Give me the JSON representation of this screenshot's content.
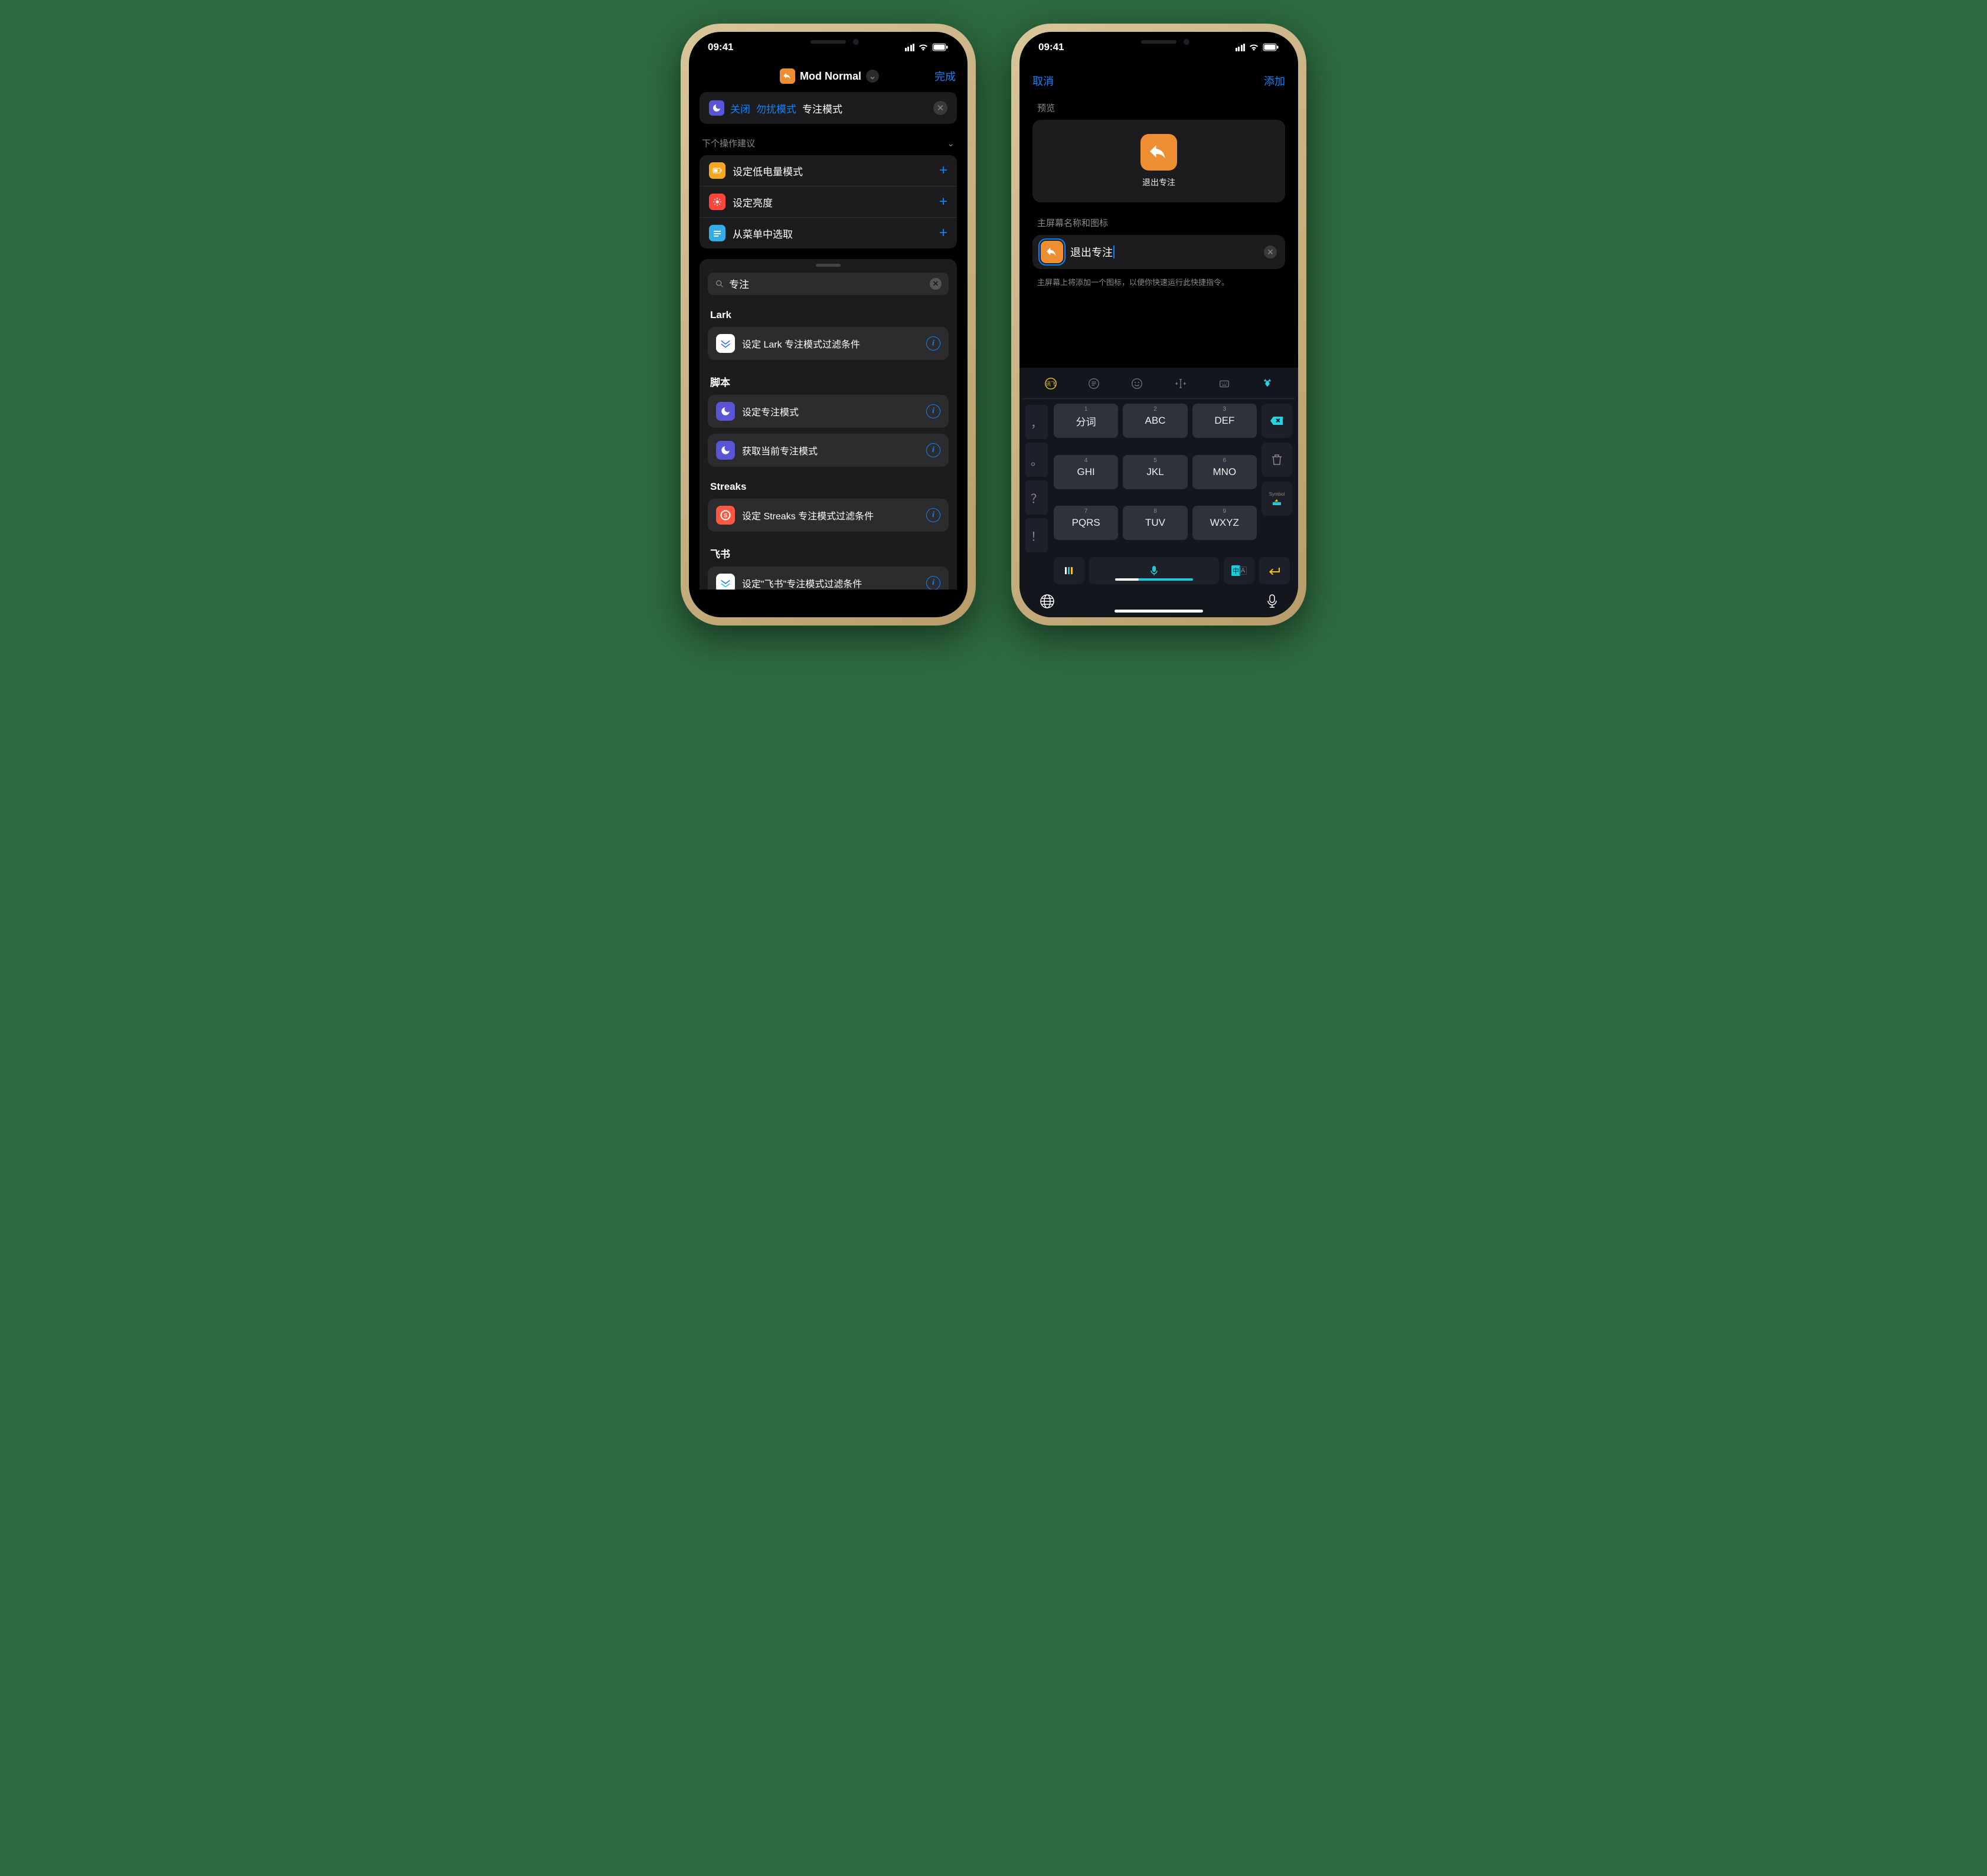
{
  "status": {
    "time": "09:41"
  },
  "left": {
    "nav": {
      "title": "Mod Normal",
      "done": "完成"
    },
    "action": {
      "toggle": "关闭",
      "mode": "勿扰模式",
      "state": "专注模式"
    },
    "sugg_header": "下个操作建议",
    "suggestions": [
      {
        "label": "设定低电量模式"
      },
      {
        "label": "设定亮度"
      },
      {
        "label": "从菜单中选取"
      }
    ],
    "search": {
      "query": "专注"
    },
    "groups": [
      {
        "name": "Lark",
        "items": [
          {
            "label": "设定 Lark 专注模式过滤条件",
            "icon": "lark"
          }
        ]
      },
      {
        "name": "脚本",
        "items": [
          {
            "label": "设定专注模式",
            "icon": "script"
          },
          {
            "label": "获取当前专注模式",
            "icon": "script"
          }
        ]
      },
      {
        "name": "Streaks",
        "items": [
          {
            "label": "设定 Streaks 专注模式过滤条件",
            "icon": "streaks"
          }
        ]
      },
      {
        "name": "飞书",
        "items": [
          {
            "label": "设定\"飞书\"专注模式过滤条件",
            "icon": "feishu"
          }
        ]
      }
    ]
  },
  "right": {
    "nav": {
      "cancel": "取消",
      "add": "添加"
    },
    "preview_label": "预览",
    "shortcut_name": "退出专注",
    "section_label": "主屏幕名称和图标",
    "input_value": "退出专注",
    "hint": "主屏幕上将添加一个图标，以便你快速运行此快捷指令。",
    "keys": [
      {
        "num": "1",
        "main": "分词"
      },
      {
        "num": "2",
        "main": "ABC"
      },
      {
        "num": "3",
        "main": "DEF"
      },
      {
        "num": "4",
        "main": "GHI"
      },
      {
        "num": "5",
        "main": "JKL"
      },
      {
        "num": "6",
        "main": "MNO"
      },
      {
        "num": "7",
        "main": "PQRS"
      },
      {
        "num": "8",
        "main": "TUV"
      },
      {
        "num": "9",
        "main": "WXYZ"
      }
    ],
    "puncts": [
      "，",
      "。",
      "？",
      "！"
    ]
  }
}
